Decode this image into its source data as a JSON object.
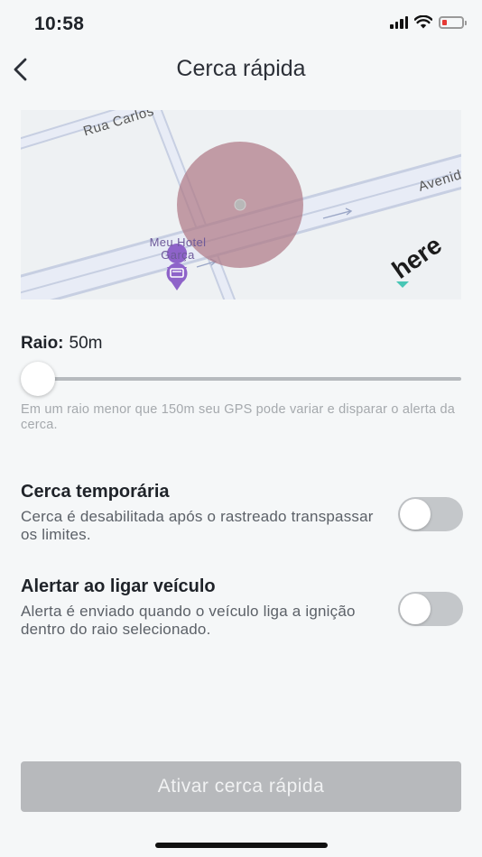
{
  "status_bar": {
    "time": "10:58",
    "icons": [
      "signal-icon",
      "wifi-icon",
      "battery-low-icon"
    ],
    "battery_color": "#e53935"
  },
  "header": {
    "title": "Cerca rápida",
    "back_icon": "chevron-left-icon"
  },
  "map": {
    "streets": [
      "Rua Carlos",
      "Avenid"
    ],
    "poi": {
      "name": "Meu Hotel Garça",
      "icon": "hotel-pin-icon",
      "color": "#8e63c9"
    },
    "provider_logo": "here",
    "fence_color": "#b07a87"
  },
  "radius": {
    "label": "Raio:",
    "value": "50m",
    "slider_fraction": 0,
    "hint": "Em um raio menor que 150m seu GPS pode variar e disparar o alerta da cerca."
  },
  "options": [
    {
      "title": "Cerca temporária",
      "description": "Cerca é desabilitada após o rastreado transpassar os limites.",
      "enabled": false
    },
    {
      "title": "Alertar ao ligar veículo",
      "description": "Alerta é enviado quando o veículo liga a ignição dentro do raio selecionado.",
      "enabled": false
    }
  ],
  "footer": {
    "button_label": "Ativar cerca rápida",
    "button_disabled": true
  }
}
